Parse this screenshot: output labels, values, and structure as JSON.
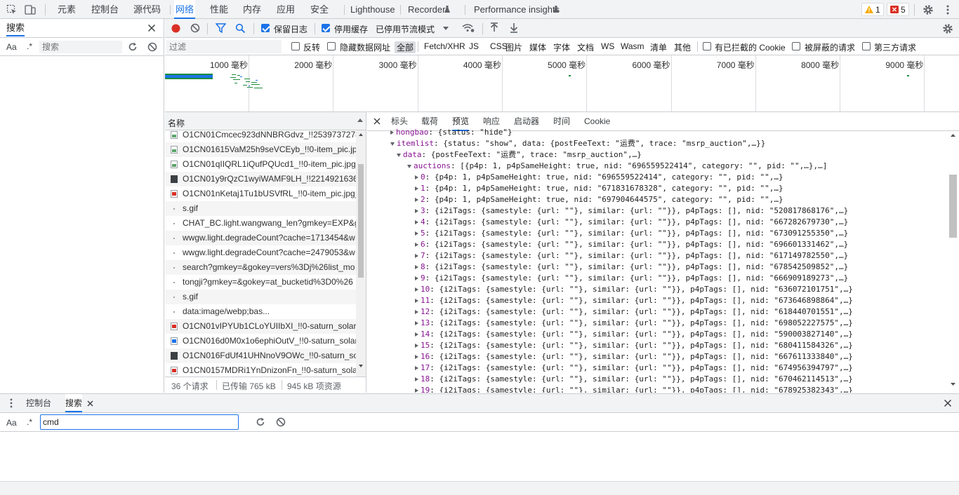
{
  "topbar": {
    "tabs": [
      "元素",
      "控制台",
      "源代码",
      "网络",
      "性能",
      "内存",
      "应用",
      "安全",
      "Lighthouse",
      "Recorder",
      "Performance insights"
    ],
    "active_tab": "网络",
    "warnings_count": "1",
    "errors_count": "5"
  },
  "left_panel": {
    "title": "搜索",
    "case_label": "Aa",
    "regex_label": ".*",
    "search_placeholder": "搜索"
  },
  "net_toolbar": {
    "preserve_log_label": "保留日志",
    "preserve_log_checked": true,
    "disable_cache_label": "停用缓存",
    "disable_cache_checked": true,
    "throttling_value": "已停用节流模式"
  },
  "filter_bar": {
    "filter_placeholder": "过滤",
    "invert_label": "反转",
    "hide_data_urls_label": "隐藏数据网址",
    "types": [
      "全部",
      "Fetch/XHR",
      "JS",
      "CSS",
      "图片",
      "媒体",
      "字体",
      "文档",
      "WS",
      "Wasm",
      "清单",
      "其他"
    ],
    "active_type": "全部",
    "blocked_cookies_label": "有已拦截的 Cookie",
    "blocked_requests_label": "被屏蔽的请求",
    "third_party_label": "第三方请求"
  },
  "overview": {
    "ticks": [
      "1000 毫秒",
      "2000 毫秒",
      "3000 毫秒",
      "4000 毫秒",
      "5000 毫秒",
      "6000 毫秒",
      "7000 毫秒",
      "8000 毫秒",
      "9000 毫秒"
    ]
  },
  "request_list": {
    "header": "名称",
    "rows": [
      {
        "name": "O1CN01Cmcec923dNNBRGdvz_!!2539737278.",
        "icon": "image-icon"
      },
      {
        "name": "O1CN01615VaM25h9seVCEyb_!!0-item_pic.jpg",
        "icon": "image-icon"
      },
      {
        "name": "O1CN01qIIQRL1iQufPQUcd1_!!0-item_pic.jpg_",
        "icon": "image-icon"
      },
      {
        "name": "O1CN01y9rQzC1wyiWAMF9LH_!!2214921636",
        "icon": "image-dark-icon"
      },
      {
        "name": "O1CN01nKetaj1Tu1bUSVfRL_!!0-item_pic.jpg_",
        "icon": "image-red-icon"
      },
      {
        "name": "s.gif",
        "icon": "dot-icon"
      },
      {
        "name": "CHAT_BC.light.wangwang_len?gmkey=EXP&gc",
        "icon": "dot-icon"
      },
      {
        "name": "wwgw.light.degradeCount?cache=1713454&w",
        "icon": "dot-icon"
      },
      {
        "name": "wwgw.light.degradeCount?cache=2479053&w",
        "icon": "dot-icon"
      },
      {
        "name": "search?gmkey=&gokey=vers%3Dj%26list_mo",
        "icon": "dot-icon"
      },
      {
        "name": "tongji?gmkey=&gokey=at_bucketid%3D0%26",
        "icon": "dot-icon"
      },
      {
        "name": "s.gif",
        "icon": "dot-icon"
      },
      {
        "name": "data:image/webp;bas...",
        "icon": "dot-icon"
      },
      {
        "name": "O1CN01vIPYUb1CLoYUIIbXI_!!0-saturn_solar.jp",
        "icon": "image-red-icon"
      },
      {
        "name": "O1CN016d0M0x1o6ephiOutV_!!0-saturn_solar",
        "icon": "image-blue-icon"
      },
      {
        "name": "O1CN016FdUf41UHNnoV9OWc_!!0-saturn_sol",
        "icon": "image-dark-icon"
      },
      {
        "name": "O1CN0157MDRi1YnDnizonFn_!!0-saturn_solar",
        "icon": "image-red-icon"
      }
    ],
    "summary": {
      "requests": "36 个请求",
      "transferred": "已传输 765 kB",
      "resources": "945 kB 项资源"
    }
  },
  "preview": {
    "tabs": [
      "标头",
      "载荷",
      "预览",
      "响应",
      "启动器",
      "时间",
      "Cookie"
    ],
    "active_tab": "预览",
    "lines": [
      {
        "indent": 0,
        "tri": "r",
        "key": "hongbao",
        "text": "{status: \"hide\"}"
      },
      {
        "indent": 0,
        "tri": "d",
        "key": "itemlist",
        "text": "{status: \"show\", data: {postFeeText: \"运费\", trace: \"msrp_auction\",…}}"
      },
      {
        "indent": 1,
        "tri": "d",
        "key": "data",
        "text": "{postFeeText: \"运费\", trace: \"msrp_auction\",…}"
      },
      {
        "indent": 2,
        "tri": "d",
        "key": "auctions",
        "text": "[{p4p: 1, p4pSameHeight: true, nid: \"696559522414\", category: \"\", pid: \"\",…},…]"
      },
      {
        "indent": 3,
        "tri": "r",
        "key": "0",
        "text": "{p4p: 1, p4pSameHeight: true, nid: \"696559522414\", category: \"\", pid: \"\",…}"
      },
      {
        "indent": 3,
        "tri": "r",
        "key": "1",
        "text": "{p4p: 1, p4pSameHeight: true, nid: \"671831678328\", category: \"\", pid: \"\",…}"
      },
      {
        "indent": 3,
        "tri": "r",
        "key": "2",
        "text": "{p4p: 1, p4pSameHeight: true, nid: \"697904644575\", category: \"\", pid: \"\",…}"
      },
      {
        "indent": 3,
        "tri": "r",
        "key": "3",
        "text": "{i2iTags: {samestyle: {url: \"\"}, similar: {url: \"\"}}, p4pTags: [], nid: \"520817868176\",…}"
      },
      {
        "indent": 3,
        "tri": "r",
        "key": "4",
        "text": "{i2iTags: {samestyle: {url: \"\"}, similar: {url: \"\"}}, p4pTags: [], nid: \"667282679730\",…}"
      },
      {
        "indent": 3,
        "tri": "r",
        "key": "5",
        "text": "{i2iTags: {samestyle: {url: \"\"}, similar: {url: \"\"}}, p4pTags: [], nid: \"673091255350\",…}"
      },
      {
        "indent": 3,
        "tri": "r",
        "key": "6",
        "text": "{i2iTags: {samestyle: {url: \"\"}, similar: {url: \"\"}}, p4pTags: [], nid: \"696601331462\",…}"
      },
      {
        "indent": 3,
        "tri": "r",
        "key": "7",
        "text": "{i2iTags: {samestyle: {url: \"\"}, similar: {url: \"\"}}, p4pTags: [], nid: \"617149782550\",…}"
      },
      {
        "indent": 3,
        "tri": "r",
        "key": "8",
        "text": "{i2iTags: {samestyle: {url: \"\"}, similar: {url: \"\"}}, p4pTags: [], nid: \"678542509852\",…}"
      },
      {
        "indent": 3,
        "tri": "r",
        "key": "9",
        "text": "{i2iTags: {samestyle: {url: \"\"}, similar: {url: \"\"}}, p4pTags: [], nid: \"666909189273\",…}"
      },
      {
        "indent": 3,
        "tri": "r",
        "key": "10",
        "text": "{i2iTags: {samestyle: {url: \"\"}, similar: {url: \"\"}}, p4pTags: [], nid: \"636072101751\",…}"
      },
      {
        "indent": 3,
        "tri": "r",
        "key": "11",
        "text": "{i2iTags: {samestyle: {url: \"\"}, similar: {url: \"\"}}, p4pTags: [], nid: \"673646898864\",…}"
      },
      {
        "indent": 3,
        "tri": "r",
        "key": "12",
        "text": "{i2iTags: {samestyle: {url: \"\"}, similar: {url: \"\"}}, p4pTags: [], nid: \"618440701551\",…}"
      },
      {
        "indent": 3,
        "tri": "r",
        "key": "13",
        "text": "{i2iTags: {samestyle: {url: \"\"}, similar: {url: \"\"}}, p4pTags: [], nid: \"698052227575\",…}"
      },
      {
        "indent": 3,
        "tri": "r",
        "key": "14",
        "text": "{i2iTags: {samestyle: {url: \"\"}, similar: {url: \"\"}}, p4pTags: [], nid: \"590003827140\",…}"
      },
      {
        "indent": 3,
        "tri": "r",
        "key": "15",
        "text": "{i2iTags: {samestyle: {url: \"\"}, similar: {url: \"\"}}, p4pTags: [], nid: \"680411584326\",…}"
      },
      {
        "indent": 3,
        "tri": "r",
        "key": "16",
        "text": "{i2iTags: {samestyle: {url: \"\"}, similar: {url: \"\"}}, p4pTags: [], nid: \"667611333840\",…}"
      },
      {
        "indent": 3,
        "tri": "r",
        "key": "17",
        "text": "{i2iTags: {samestyle: {url: \"\"}, similar: {url: \"\"}}, p4pTags: [], nid: \"674956394797\",…}"
      },
      {
        "indent": 3,
        "tri": "r",
        "key": "18",
        "text": "{i2iTags: {samestyle: {url: \"\"}, similar: {url: \"\"}}, p4pTags: [], nid: \"670462114513\",…}"
      },
      {
        "indent": 3,
        "tri": "r",
        "key": "19",
        "text": "{i2iTags: {samestyle: {url: \"\"}, similar: {url: \"\"}}, p4pTags: [], nid: \"678925382343\",…}"
      }
    ]
  },
  "drawer": {
    "tabs": [
      "控制台",
      "搜索"
    ],
    "active_tab": "搜索",
    "case_label": "Aa",
    "regex_label": ".*",
    "search_value": "cmd"
  },
  "colors": {
    "accent": "#1a73e8",
    "record_red": "#d93025",
    "warning_yellow": "#f9ab00"
  }
}
